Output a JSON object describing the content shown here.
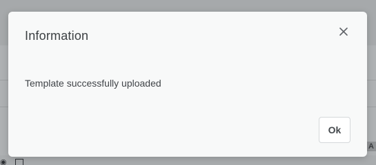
{
  "background": {
    "tag_text": "A"
  },
  "dialog": {
    "title": "Information",
    "message": "Template successfully uploaded",
    "ok_label": "Ok",
    "close_icon": "close-icon"
  },
  "colors": {
    "overlay": "#a9acae",
    "dialog_bg": "#f8f9f9",
    "title_text": "#3c4043",
    "button_border": "#d5d8da"
  }
}
